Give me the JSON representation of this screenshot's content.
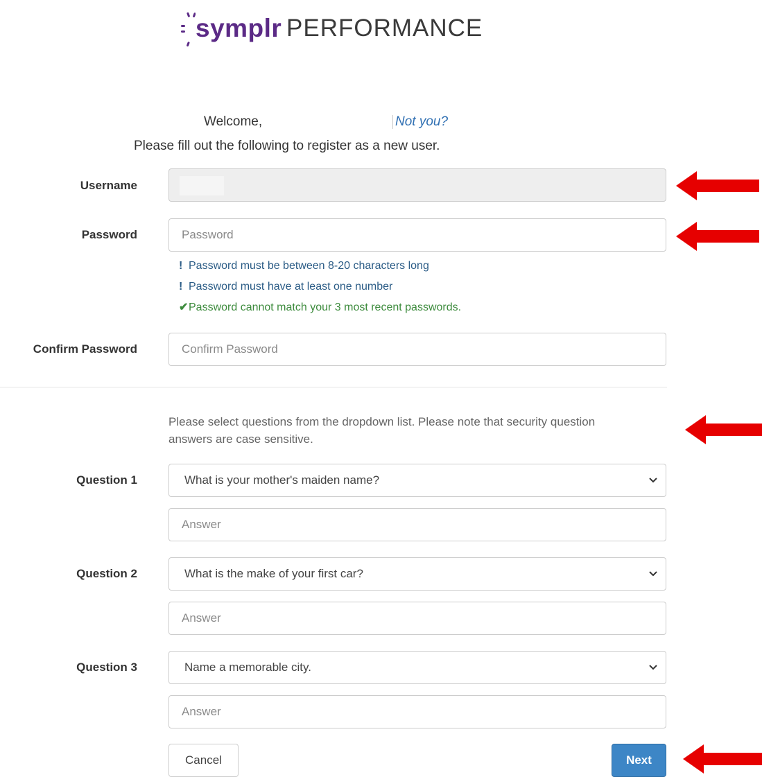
{
  "logo": {
    "brand": "symplr",
    "product": "PERFORMANCE"
  },
  "welcome": {
    "greeting": "Welcome,",
    "not_you": "Not you?"
  },
  "intro": "Please fill out the following to register as a new user.",
  "fields": {
    "username": {
      "label": "Username",
      "value": ""
    },
    "password": {
      "label": "Password",
      "placeholder": "Password"
    },
    "confirm_password": {
      "label": "Confirm Password",
      "placeholder": "Confirm Password"
    }
  },
  "password_rules": [
    {
      "icon": "!",
      "text": "Password must be between 8-20 characters long",
      "status": "error"
    },
    {
      "icon": "!",
      "text": "Password must have at least one number",
      "status": "error"
    },
    {
      "icon": "✔",
      "text": "Password cannot match your 3 most recent passwords.",
      "status": "ok"
    }
  ],
  "security_note": "Please select questions from the dropdown list. Please note that security question answers are case sensitive.",
  "questions": [
    {
      "label": "Question 1",
      "selected": "What is your mother's maiden name?",
      "answer_placeholder": "Answer"
    },
    {
      "label": "Question 2",
      "selected": "What is the make of your first car?",
      "answer_placeholder": "Answer"
    },
    {
      "label": "Question 3",
      "selected": "Name a memorable city.",
      "answer_placeholder": "Answer"
    }
  ],
  "buttons": {
    "cancel": "Cancel",
    "next": "Next"
  },
  "colors": {
    "brand_purple": "#5b2a86",
    "link_blue": "#2f6fb2",
    "primary_button": "#3d86c6",
    "annotation_arrow": "#e60000",
    "rule_error": "#2b5c86",
    "rule_ok": "#3d8b3d"
  }
}
